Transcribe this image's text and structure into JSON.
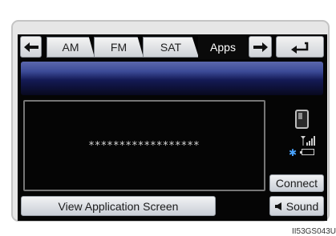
{
  "tabs": [
    {
      "label": "AM",
      "active": false
    },
    {
      "label": "FM",
      "active": false
    },
    {
      "label": "SAT",
      "active": false
    },
    {
      "label": "Apps",
      "active": true
    }
  ],
  "device_code": "******************",
  "buttons": {
    "connect": "Connect",
    "view_app": "View Application Screen",
    "sound": "Sound"
  },
  "icons": {
    "back": "back-arrow-icon",
    "prev": "left-arrow-icon",
    "next": "right-arrow-icon",
    "speaker": "speaker-icon"
  },
  "caption": "II53GS043U",
  "colors": {
    "band_top": "#5b67ad",
    "band_bottom": "#08091e",
    "bluetooth": "#4aa4ff"
  }
}
